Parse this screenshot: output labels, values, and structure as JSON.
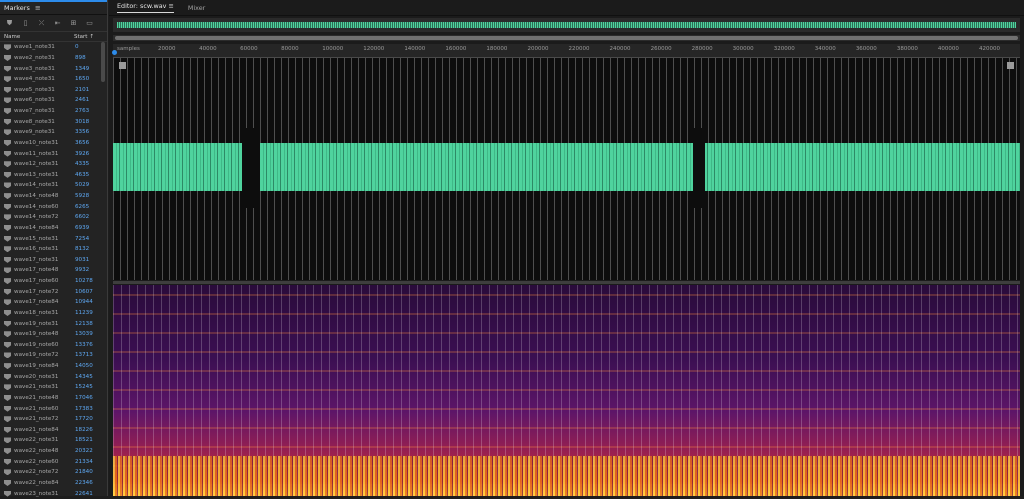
{
  "markers_panel": {
    "title": "Markers",
    "menu_icon": "hamburger-icon",
    "col_name": "Name",
    "col_start": "Start",
    "sort_icon": "arrow-up-icon",
    "rows": [
      {
        "name": "wave1_note31",
        "start": "0"
      },
      {
        "name": "wave2_note31",
        "start": "898"
      },
      {
        "name": "wave3_note31",
        "start": "1349"
      },
      {
        "name": "wave4_note31",
        "start": "1650"
      },
      {
        "name": "wave5_note31",
        "start": "2101"
      },
      {
        "name": "wave6_note31",
        "start": "2461"
      },
      {
        "name": "wave7_note31",
        "start": "2763"
      },
      {
        "name": "wave8_note31",
        "start": "3018"
      },
      {
        "name": "wave9_note31",
        "start": "3356"
      },
      {
        "name": "wave10_note31",
        "start": "3656"
      },
      {
        "name": "wave11_note31",
        "start": "3926"
      },
      {
        "name": "wave12_note31",
        "start": "4335"
      },
      {
        "name": "wave13_note31",
        "start": "4635"
      },
      {
        "name": "wave14_note31",
        "start": "5029"
      },
      {
        "name": "wave14_note48",
        "start": "5928"
      },
      {
        "name": "wave14_note60",
        "start": "6265"
      },
      {
        "name": "wave14_note72",
        "start": "6602"
      },
      {
        "name": "wave14_note84",
        "start": "6939"
      },
      {
        "name": "wave15_note31",
        "start": "7254"
      },
      {
        "name": "wave16_note31",
        "start": "8132"
      },
      {
        "name": "wave17_note31",
        "start": "9031"
      },
      {
        "name": "wave17_note48",
        "start": "9932"
      },
      {
        "name": "wave17_note60",
        "start": "10278"
      },
      {
        "name": "wave17_note72",
        "start": "10607"
      },
      {
        "name": "wave17_note84",
        "start": "10944"
      },
      {
        "name": "wave18_note31",
        "start": "11239"
      },
      {
        "name": "wave19_note31",
        "start": "12138"
      },
      {
        "name": "wave19_note48",
        "start": "13039"
      },
      {
        "name": "wave19_note60",
        "start": "13376"
      },
      {
        "name": "wave19_note72",
        "start": "13713"
      },
      {
        "name": "wave19_note84",
        "start": "14050"
      },
      {
        "name": "wave20_note31",
        "start": "14345"
      },
      {
        "name": "wave21_note31",
        "start": "15245"
      },
      {
        "name": "wave21_note48",
        "start": "17046"
      },
      {
        "name": "wave21_note60",
        "start": "17383"
      },
      {
        "name": "wave21_note72",
        "start": "17720"
      },
      {
        "name": "wave21_note84",
        "start": "18226"
      },
      {
        "name": "wave22_note31",
        "start": "18521"
      },
      {
        "name": "wave22_note48",
        "start": "20322"
      },
      {
        "name": "wave22_note60",
        "start": "21334"
      },
      {
        "name": "wave22_note72",
        "start": "21840"
      },
      {
        "name": "wave22_note84",
        "start": "22346"
      },
      {
        "name": "wave23_note31",
        "start": "22641"
      }
    ]
  },
  "editor": {
    "tab_editor": "Editor: scw.wav",
    "tab_menu_icon": "hamburger-icon",
    "tab_mixer": "Mixer",
    "ruler_labels": [
      "samples",
      "20000",
      "40000",
      "60000",
      "80000",
      "100000",
      "120000",
      "140000",
      "160000",
      "180000",
      "200000",
      "220000",
      "240000",
      "260000",
      "280000",
      "300000",
      "320000",
      "340000",
      "360000",
      "380000",
      "400000",
      "420000"
    ]
  },
  "colors": {
    "waveform": "#4fd39e",
    "accent": "#2d8ceb",
    "marker_start": "#5ea8f3"
  }
}
